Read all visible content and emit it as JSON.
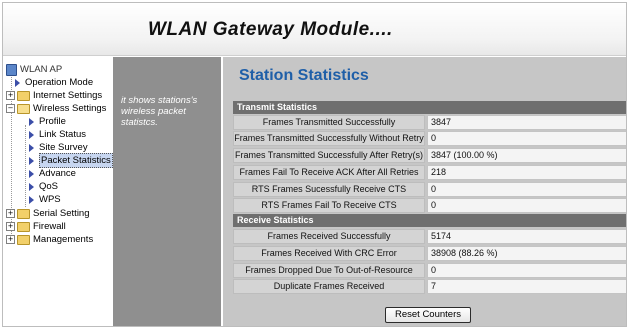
{
  "header": {
    "title": "WLAN Gateway Module...."
  },
  "nav": {
    "root": "WLAN AP",
    "items": [
      {
        "label": "Operation Mode"
      },
      {
        "label": "Internet Settings"
      },
      {
        "label": "Wireless Settings"
      },
      {
        "label": "Profile"
      },
      {
        "label": "Link Status"
      },
      {
        "label": "Site Survey"
      },
      {
        "label": "Packet Statistics"
      },
      {
        "label": "Advance"
      },
      {
        "label": "QoS"
      },
      {
        "label": "WPS"
      },
      {
        "label": "Serial Setting"
      },
      {
        "label": "Firewall"
      },
      {
        "label": "Managements"
      }
    ]
  },
  "description": "it shows stations's wireless packet statistcs.",
  "main": {
    "title": "Station Statistics",
    "transmit": {
      "header": "Transmit Statistics",
      "rows": [
        {
          "label": "Frames Transmitted Successfully",
          "value": "3847"
        },
        {
          "label": "Frames Transmitted Successfully Without Retry",
          "value": "0"
        },
        {
          "label": "Frames Transmitted Successfully After Retry(s)",
          "value": "3847 (100.00 %)"
        },
        {
          "label": "Frames Fail To Receive ACK After All Retries",
          "value": "218"
        },
        {
          "label": "RTS Frames Sucessfully Receive CTS",
          "value": "0"
        },
        {
          "label": "RTS Frames Fail To Receive CTS",
          "value": "0"
        }
      ]
    },
    "receive": {
      "header": "Receive Statistics",
      "rows": [
        {
          "label": "Frames Received Successfully",
          "value": "5174"
        },
        {
          "label": "Frames Received With CRC Error",
          "value": "38908 (88.26 %)"
        },
        {
          "label": "Frames Dropped Due To Out-of-Resource",
          "value": "0"
        },
        {
          "label": "Duplicate Frames Received",
          "value": "7"
        }
      ]
    },
    "reset_button": "Reset Counters"
  }
}
